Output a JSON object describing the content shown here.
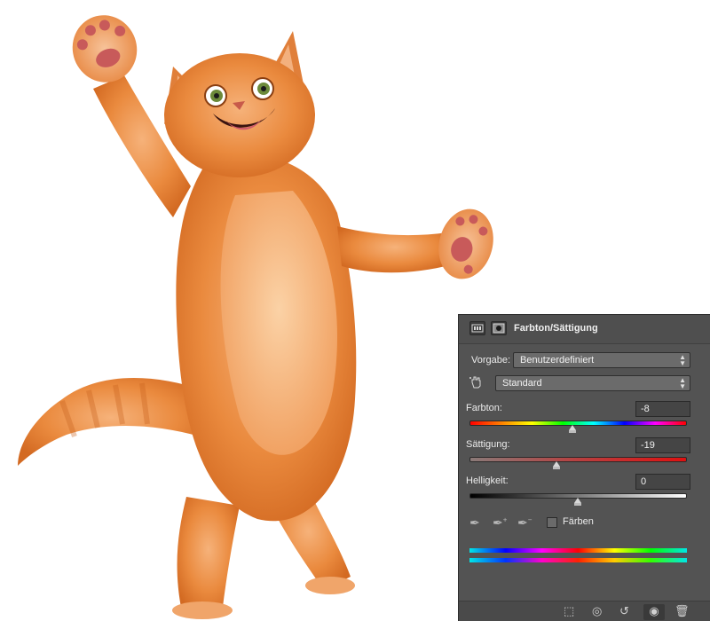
{
  "panel": {
    "title": "Farbton/Sättigung",
    "preset_label": "Vorgabe:",
    "preset_value": "Benutzerdefiniert",
    "channel_value": "Standard",
    "hue_label": "Farbton:",
    "hue_value": "-8",
    "hue_level": -8,
    "saturation_label": "Sättigung:",
    "saturation_value": "-19",
    "saturation_level": -19,
    "lightness_label": "Helligkeit:",
    "lightness_value": "0",
    "lightness_level": 0,
    "colorize_label": "Färben",
    "colorize_checked": false
  },
  "icons": {
    "adjustment": "adjustment-layer-icon",
    "mask": "mask-icon",
    "hand": "targeted-adjustment-icon",
    "eyedropper": "eyedropper-icon",
    "eyedropper_add": "eyedropper-plus-icon",
    "eyedropper_sub": "eyedropper-minus-icon",
    "clip": "clip-to-layer-icon",
    "view_prev": "view-previous-state-icon",
    "reset": "reset-icon",
    "visibility": "eye-icon",
    "delete": "trash-icon"
  },
  "colors": {
    "panel_bg": "#535353",
    "fur_orange": "#e8853a"
  }
}
